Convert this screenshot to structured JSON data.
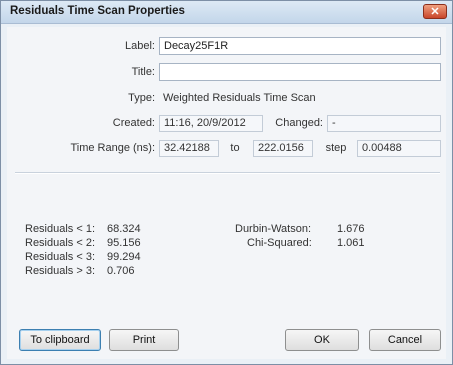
{
  "window": {
    "title": "Residuals Time Scan Properties",
    "close_label": "✕"
  },
  "fields": {
    "label_caption": "Label:",
    "label_value": "Decay25F1R",
    "title_caption": "Title:",
    "title_value": "",
    "type_caption": "Type:",
    "type_value": "Weighted Residuals Time Scan",
    "created_caption": "Created:",
    "created_value": "11:16, 20/9/2012",
    "changed_caption": "Changed:",
    "changed_value": "-",
    "time_range_caption": "Time Range (ns):",
    "time_range_from": "32.42188",
    "to_caption": "to",
    "time_range_to": "222.0156",
    "step_caption": "step",
    "step_value": "0.00488"
  },
  "stats": {
    "left": [
      {
        "label": "Residuals < 1:",
        "value": "68.324"
      },
      {
        "label": "Residuals < 2:",
        "value": "95.156"
      },
      {
        "label": "Residuals < 3:",
        "value": "99.294"
      },
      {
        "label": "Residuals > 3:",
        "value": "0.706"
      }
    ],
    "right": [
      {
        "label": "Durbin-Watson:",
        "value": "1.676"
      },
      {
        "label": "Chi-Squared:",
        "value": "1.061"
      }
    ]
  },
  "buttons": {
    "clipboard": "To clipboard",
    "print": "Print",
    "ok": "OK",
    "cancel": "Cancel"
  }
}
